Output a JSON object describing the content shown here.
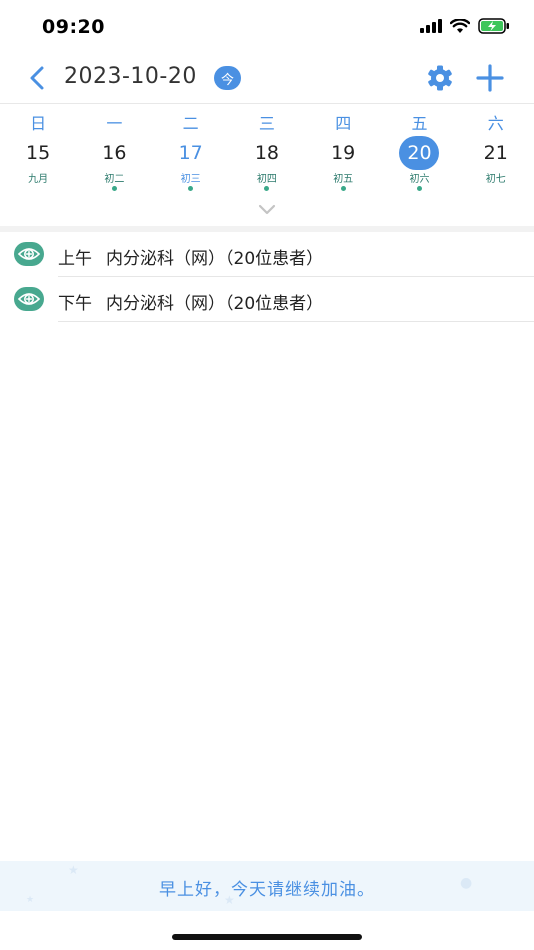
{
  "status_bar": {
    "time": "09:20"
  },
  "header": {
    "date": "2023-10-20",
    "today_badge": "今"
  },
  "week": {
    "days": [
      {
        "weekday": "日",
        "day": "15",
        "lunar": "九月",
        "dot": false,
        "state": "normal"
      },
      {
        "weekday": "一",
        "day": "16",
        "lunar": "初二",
        "dot": true,
        "state": "normal"
      },
      {
        "weekday": "二",
        "day": "17",
        "lunar": "初三",
        "dot": true,
        "state": "today"
      },
      {
        "weekday": "三",
        "day": "18",
        "lunar": "初四",
        "dot": true,
        "state": "normal"
      },
      {
        "weekday": "四",
        "day": "19",
        "lunar": "初五",
        "dot": true,
        "state": "normal"
      },
      {
        "weekday": "五",
        "day": "20",
        "lunar": "初六",
        "dot": true,
        "state": "selected"
      },
      {
        "weekday": "六",
        "day": "21",
        "lunar": "初七",
        "dot": false,
        "state": "normal"
      }
    ]
  },
  "schedule": [
    {
      "period": "上午",
      "dept": "内分泌科（网）",
      "count": "（20位患者）"
    },
    {
      "period": "下午",
      "dept": "内分泌科（网）",
      "count": "（20位患者）"
    }
  ],
  "footer": {
    "message": "早上好，今天请继续加油。"
  },
  "colors": {
    "accent": "#4a90e2",
    "green": "#48a88f"
  }
}
